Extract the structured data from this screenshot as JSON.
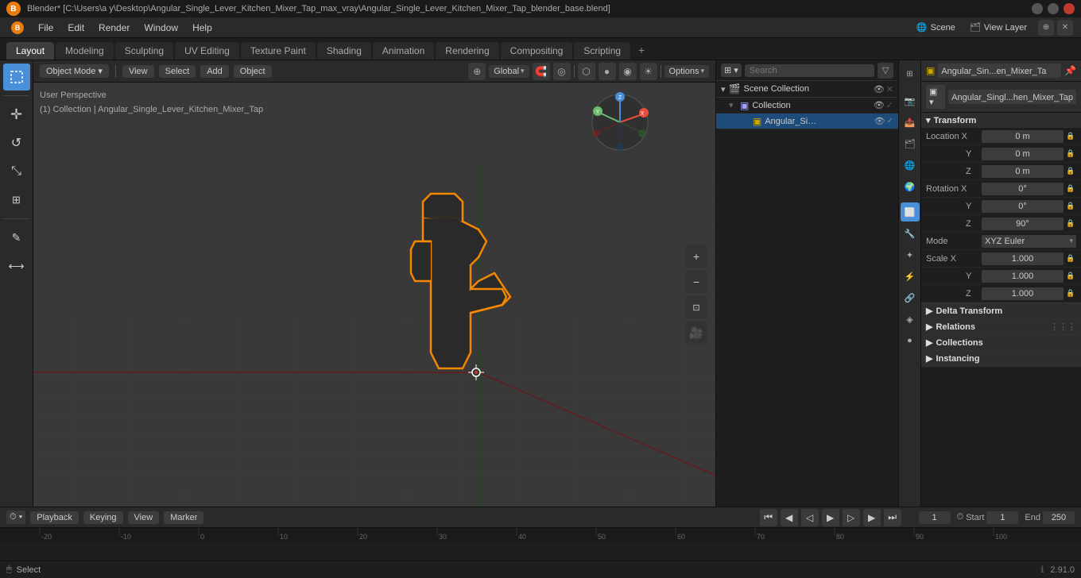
{
  "titlebar": {
    "title": "Blender* [C:\\Users\\a y\\Desktop\\Angular_Single_Lever_Kitchen_Mixer_Tap_max_vray\\Angular_Single_Lever_Kitchen_Mixer_Tap_blender_base.blend]",
    "controls": [
      "minimize",
      "maximize",
      "close"
    ]
  },
  "menubar": {
    "items": [
      "Blender",
      "File",
      "Edit",
      "Render",
      "Window",
      "Help"
    ]
  },
  "workspace_tabs": {
    "tabs": [
      "Layout",
      "Modeling",
      "Sculpting",
      "UV Editing",
      "Texture Paint",
      "Shading",
      "Animation",
      "Rendering",
      "Compositing",
      "Scripting"
    ],
    "active": "Layout",
    "add_icon": "+"
  },
  "viewport_header": {
    "mode": "Object Mode",
    "view_label": "View",
    "select_label": "Select",
    "add_label": "Add",
    "object_label": "Object",
    "transform": "Global",
    "options_label": "Options"
  },
  "viewport_info": {
    "perspective": "User Perspective",
    "collection": "(1) Collection | Angular_Single_Lever_Kitchen_Mixer_Tap"
  },
  "outliner": {
    "search_placeholder": "Search",
    "scene_collection_label": "Scene Collection",
    "items": [
      {
        "level": 0,
        "label": "Collection",
        "type": "collection",
        "expanded": true,
        "visible": true
      },
      {
        "level": 1,
        "label": "Angular_Single_Leve",
        "type": "mesh",
        "selected": true,
        "visible": true
      }
    ]
  },
  "view_layer": {
    "label": "View Layer"
  },
  "properties": {
    "object_name": "Angular_Sin...en_Mixer_Ta",
    "data_name": "Angular_Singl...hen_Mixer_Tap",
    "sections": {
      "transform": {
        "label": "Transform",
        "location": {
          "x": "0 m",
          "y": "0 m",
          "z": "0 m"
        },
        "rotation": {
          "x": "0°",
          "y": "0°",
          "z": "90°"
        },
        "mode": "XYZ Euler",
        "scale": {
          "x": "1.000",
          "y": "1.000",
          "z": "1.000"
        }
      },
      "delta_transform": {
        "label": "Delta Transform",
        "collapsed": true
      },
      "relations": {
        "label": "Relations",
        "collapsed": true
      },
      "collections": {
        "label": "Collections",
        "collapsed": true
      },
      "instancing": {
        "label": "Instancing",
        "collapsed": true
      }
    }
  },
  "prop_icons": [
    {
      "name": "scene-icon",
      "symbol": "🎬",
      "active": false
    },
    {
      "name": "render-icon",
      "symbol": "📷",
      "active": false
    },
    {
      "name": "output-icon",
      "symbol": "📤",
      "active": false
    },
    {
      "name": "view-layer-icon",
      "symbol": "🗂",
      "active": false
    },
    {
      "name": "scene-prop-icon",
      "symbol": "🌐",
      "active": false
    },
    {
      "name": "world-icon",
      "symbol": "🌍",
      "active": false
    },
    {
      "name": "object-icon",
      "symbol": "⬜",
      "active": true
    },
    {
      "name": "modifier-icon",
      "symbol": "🔧",
      "active": false
    },
    {
      "name": "particles-icon",
      "symbol": "✦",
      "active": false
    },
    {
      "name": "physics-icon",
      "symbol": "⚡",
      "active": false
    },
    {
      "name": "constraints-icon",
      "symbol": "🔗",
      "active": false
    },
    {
      "name": "data-icon",
      "symbol": "◈",
      "active": false
    },
    {
      "name": "material-icon",
      "symbol": "●",
      "active": false
    },
    {
      "name": "shader-icon",
      "symbol": "◉",
      "active": false
    }
  ],
  "timeline": {
    "playback_label": "Playback",
    "keying_label": "Keying",
    "view_label": "View",
    "marker_label": "Marker",
    "frame_current": "1",
    "frame_start_label": "Start",
    "frame_start": "1",
    "frame_end_label": "End",
    "frame_end": "250"
  },
  "statusbar": {
    "left": "Select",
    "version": "2.91.0"
  },
  "tools": [
    {
      "name": "select-box",
      "symbol": "⬚",
      "active": true
    },
    {
      "name": "move",
      "symbol": "✛"
    },
    {
      "name": "rotate",
      "symbol": "↺"
    },
    {
      "name": "scale",
      "symbol": "⤡"
    },
    {
      "name": "transform",
      "symbol": "⊞"
    },
    {
      "name": "annotate",
      "symbol": "✎"
    },
    {
      "name": "measure",
      "symbol": "⟷"
    }
  ]
}
